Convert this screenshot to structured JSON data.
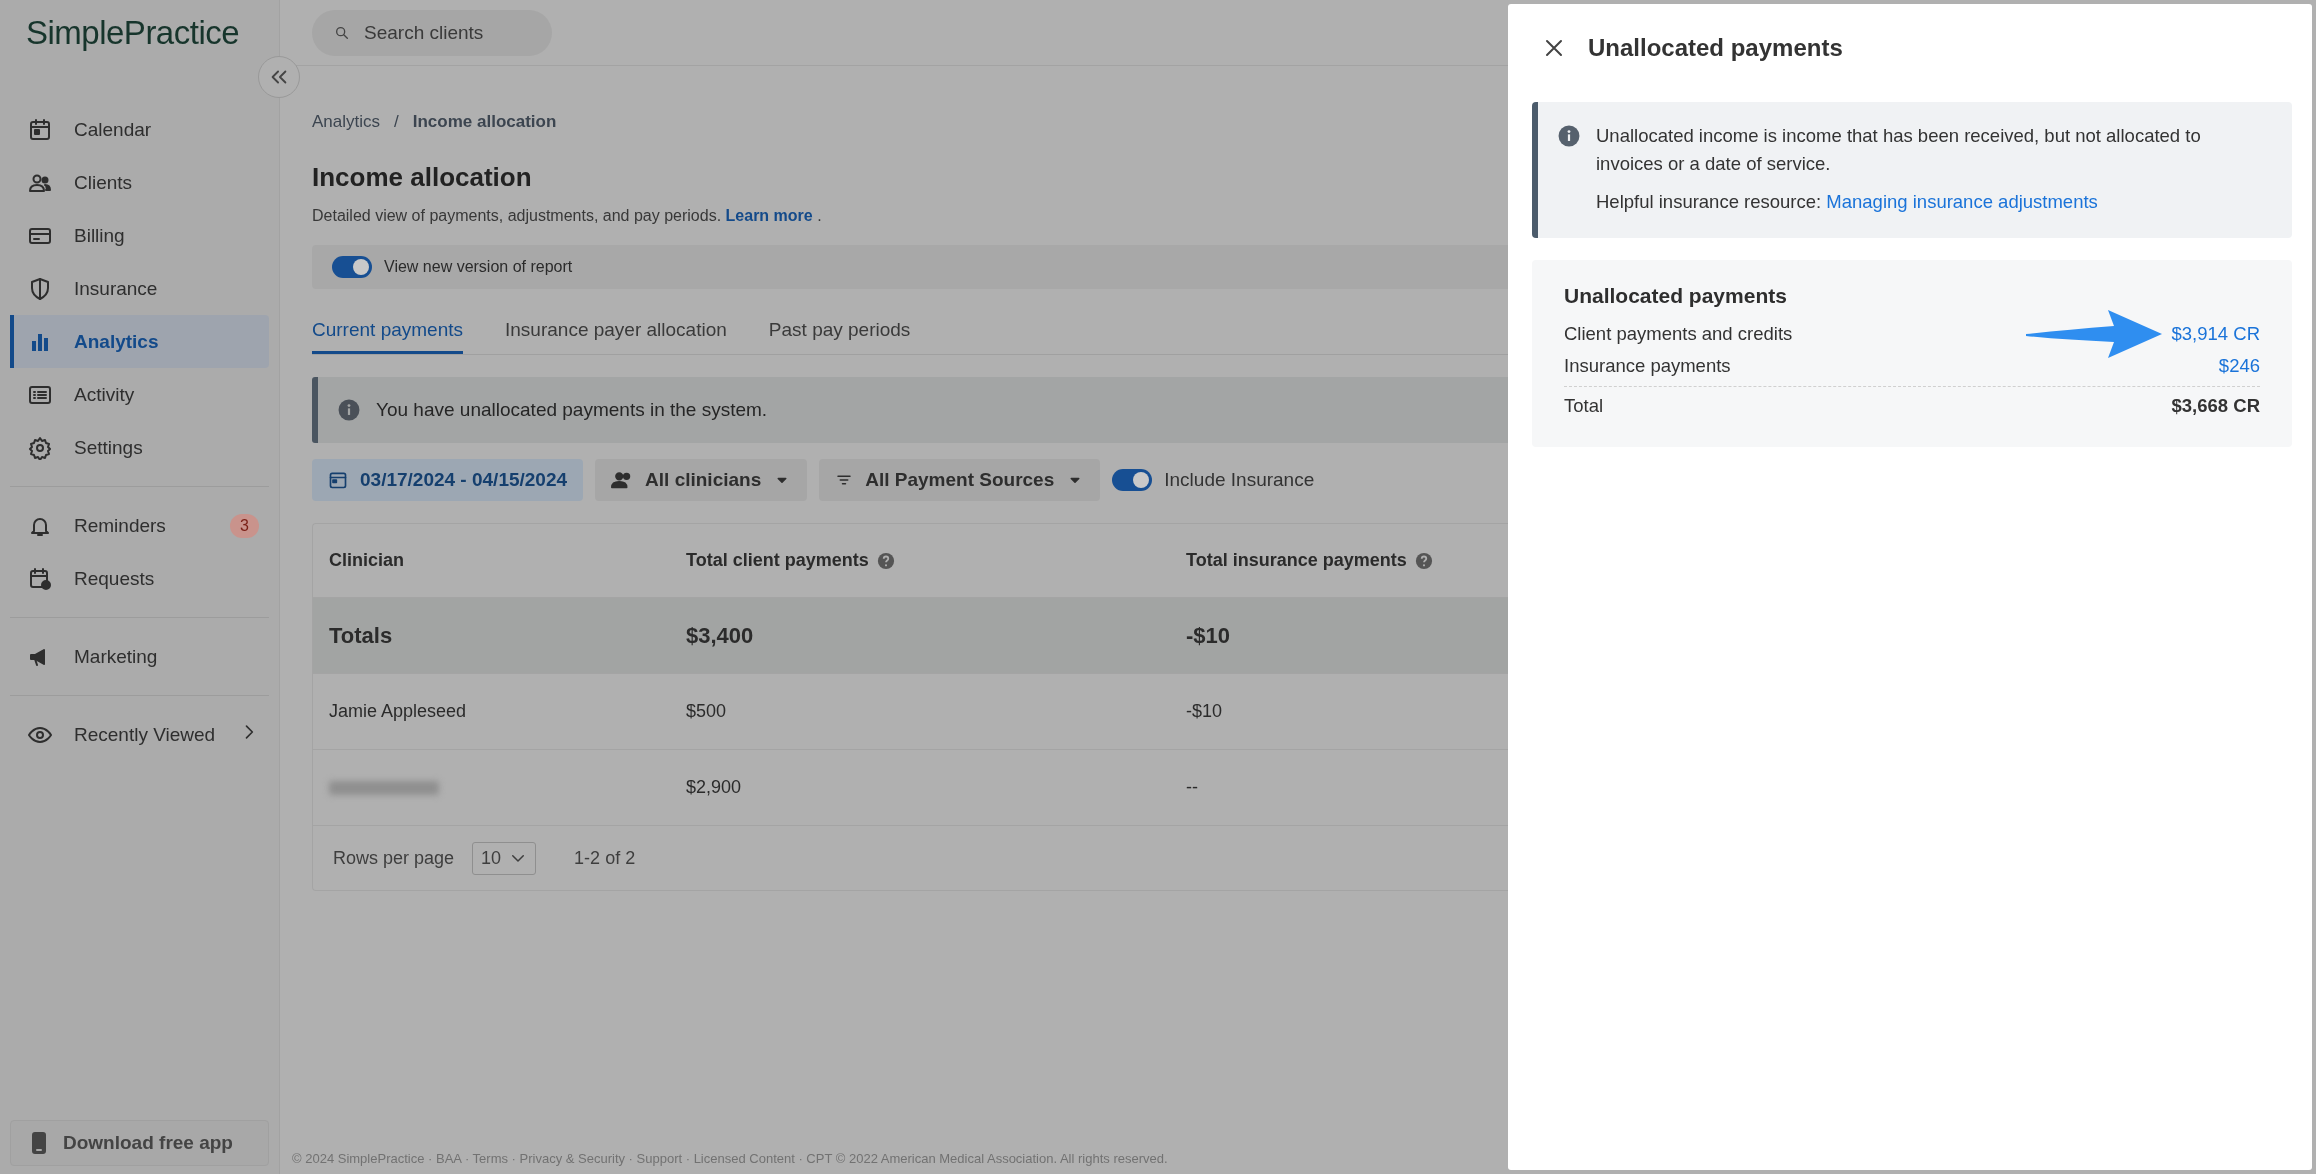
{
  "sidebar": {
    "logo": "SimplePractice",
    "sections": [
      [
        {
          "label": "Calendar",
          "selected": false
        },
        {
          "label": "Clients",
          "selected": false
        },
        {
          "label": "Billing",
          "selected": false
        },
        {
          "label": "Insurance",
          "selected": false
        },
        {
          "label": "Analytics",
          "selected": true
        },
        {
          "label": "Activity",
          "selected": false
        },
        {
          "label": "Settings",
          "selected": false
        }
      ],
      [
        {
          "label": "Reminders",
          "selected": false,
          "badge": "3"
        },
        {
          "label": "Requests",
          "selected": false
        }
      ],
      [
        {
          "label": "Marketing",
          "selected": false
        }
      ],
      [
        {
          "label": "Recently Viewed",
          "selected": false,
          "has_submenu": true
        }
      ]
    ],
    "download_button": "Download free app"
  },
  "search": {
    "placeholder": "Search clients"
  },
  "breadcrumb": {
    "separator": "/",
    "items": [
      {
        "label": "Analytics",
        "current": false
      },
      {
        "label": "Income allocation",
        "current": true
      }
    ]
  },
  "page": {
    "title": "Income allocation",
    "description": "Detailed view of payments, adjustments, and pay periods.",
    "learn_more": "Learn more",
    "after_link": "."
  },
  "new_version_toggle": {
    "label": "View new version of report",
    "on": true
  },
  "tabs": [
    {
      "label": "Current payments",
      "selected": true
    },
    {
      "label": "Insurance payer allocation",
      "selected": false
    },
    {
      "label": "Past pay periods",
      "selected": false
    }
  ],
  "alert": {
    "text": "You have unallocated payments in the system."
  },
  "filters": {
    "date_range": "03/17/2024 - 04/15/2024",
    "clinicians": "All clinicians",
    "sources": "All Payment Sources",
    "include_insurance": {
      "label": "Include Insurance",
      "on": true
    }
  },
  "table": {
    "columns": [
      {
        "label": "Clinician"
      },
      {
        "label": "Total client payments",
        "help": true
      },
      {
        "label": "Total insurance payments",
        "help": true
      }
    ],
    "rows": [
      {
        "kind": "totals",
        "clinician": "Totals",
        "client_payments": "$3,400",
        "insurance_payments": "-$10"
      },
      {
        "kind": "data",
        "clinician": "Jamie Appleseed",
        "client_payments": "$500",
        "insurance_payments": "-$10"
      },
      {
        "kind": "redacted",
        "client_payments": "$2,900",
        "insurance_payments": "--"
      }
    ],
    "pagination": {
      "rows_per_page_label": "Rows per page",
      "rows_per_page": "10",
      "range": "1-2 of 2"
    }
  },
  "footer": "© 2024 SimplePractice · BAA · Terms · Privacy & Security · Support · Licensed Content · CPT © 2022 American Medical Association. All rights reserved.",
  "panel": {
    "title": "Unallocated payments",
    "info": {
      "text": "Unallocated income is income that has been received, but not allocated to invoices or a date of service.",
      "resource_label": "Helpful insurance resource:",
      "resource_link": "Managing insurance adjustments"
    },
    "summary": {
      "heading": "Unallocated payments",
      "lines": [
        {
          "kind": "link",
          "label": "Client payments and credits",
          "value": "$3,914 CR",
          "pointed_at": true
        },
        {
          "kind": "link",
          "label": "Insurance payments",
          "value": "$246",
          "pointed_at": false
        },
        {
          "kind": "total",
          "label": "Total",
          "value": "$3,668 CR",
          "pointed_at": false
        }
      ]
    }
  }
}
